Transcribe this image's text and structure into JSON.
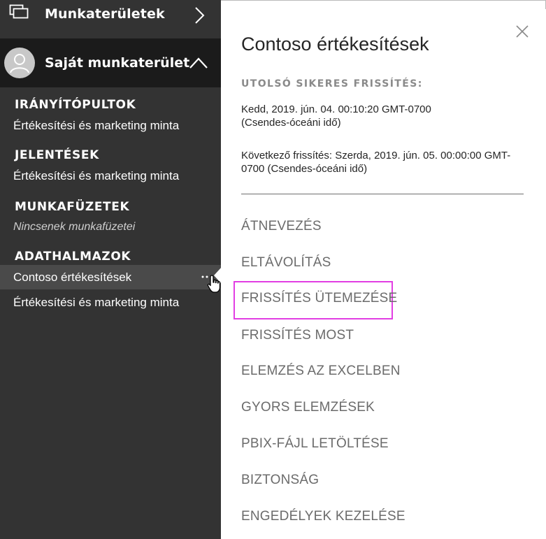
{
  "sidebar": {
    "workspaces_label": "Munkaterületek",
    "my_workspace_label": "Saját munkaterület",
    "sections": {
      "dashboards_title": "IRÁNYÍTÓPULTOK",
      "dashboards_items": [
        "Értékesítési és marketing minta"
      ],
      "reports_title": "JELENTÉSEK",
      "reports_items": [
        "Értékesítési és marketing minta"
      ],
      "workbooks_title": "MUNKAFÜZETEK",
      "workbooks_empty": "Nincsenek munkafüzetei",
      "datasets_title": "ADATHALMAZOK",
      "datasets_items": [
        "Contoso értékesítések",
        "Értékesítési és marketing minta"
      ]
    }
  },
  "panel": {
    "title": "Contoso értékesítések",
    "last_refresh_heading": "UTOLSÓ SIKERES FRISSÍTÉS:",
    "last_refresh_value": "Kedd, 2019. jún. 04. 00:10:20 GMT-0700 (Csendes-óceáni idő)",
    "next_refresh_value": "Következő frissítés: Szerda, 2019. jún. 05. 00:00:00 GMT-0700 (Csendes-óceáni idő)",
    "menu": [
      "ÁTNEVEZÉS",
      "ELTÁVOLÍTÁS",
      "FRISSÍTÉS ÜTEMEZÉSE",
      "FRISSÍTÉS MOST",
      "ELEMZÉS AZ EXCELBEN",
      "GYORS ELEMZÉSEK",
      "PBIX-FÁJL LETÖLTÉSE",
      "BIZTONSÁG",
      "ENGEDÉLYEK KEZELÉSE"
    ],
    "highlight_color": "#e23ee3"
  },
  "colors": {
    "sidebar_bg": "#333333",
    "my_workspace_bg": "#1b1b1b",
    "selected_dataset_bg": "#4a4a4a"
  }
}
